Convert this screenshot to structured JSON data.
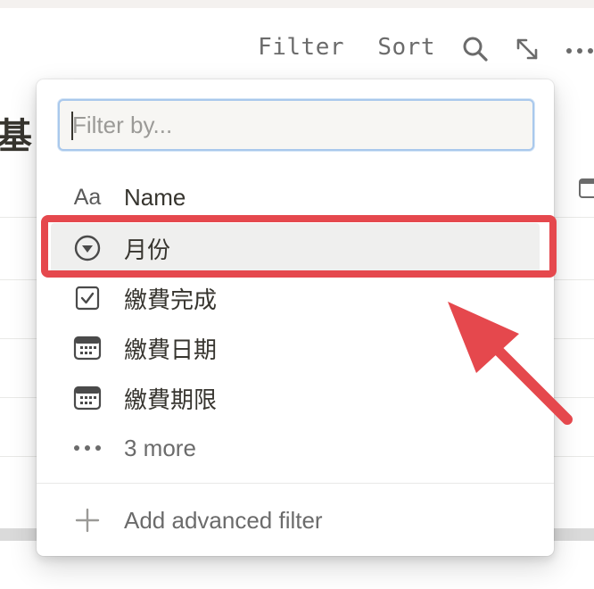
{
  "toolbar": {
    "filter_label": "Filter",
    "sort_label": "Sort",
    "search_icon": "search-icon",
    "expand_icon": "expand-icon",
    "more_icon": "more-icon"
  },
  "background": {
    "title_fragment": "基"
  },
  "filter_popup": {
    "input_placeholder": "Filter by...",
    "input_value": "",
    "properties": [
      {
        "icon": "text-type-icon",
        "icon_text": "Aa",
        "label": "Name"
      },
      {
        "icon": "select-icon",
        "label": "月份"
      },
      {
        "icon": "checkbox-icon",
        "label": "繳費完成"
      },
      {
        "icon": "calendar-icon",
        "label": "繳費日期"
      },
      {
        "icon": "calendar-icon",
        "label": "繳費期限"
      }
    ],
    "more_label": "3 more",
    "advanced_label": "Add advanced filter"
  },
  "annotation": {
    "highlight_color": "#e5484d",
    "highlighted_item": "月份"
  },
  "colors": {
    "input_focus_border": "#a9c8ec",
    "hover_row": "#efefee",
    "text_primary": "#37352f",
    "text_secondary": "#6b6b6b"
  }
}
